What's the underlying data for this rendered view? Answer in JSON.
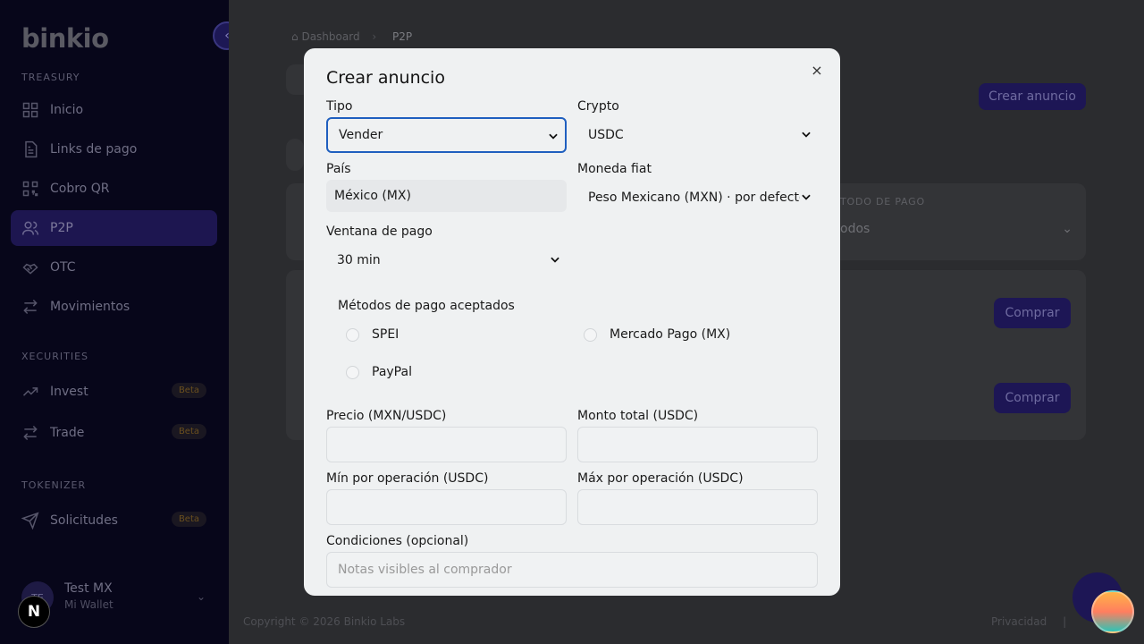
{
  "sidebar": {
    "logo": "binkio",
    "sections": {
      "treasury": "TREASURY",
      "securities": "XECURITIES",
      "tokenizer": "TOKENIZER"
    },
    "items": [
      {
        "label": "Inicio",
        "icon": "grid-icon"
      },
      {
        "label": "Links de pago",
        "icon": "document-icon"
      },
      {
        "label": "Cobro QR",
        "icon": "qr-icon"
      },
      {
        "label": "P2P",
        "icon": "users-icon"
      },
      {
        "label": "OTC",
        "icon": "handshake-icon"
      },
      {
        "label": "Movimientos",
        "icon": "swap-icon"
      },
      {
        "label": "Invest",
        "icon": "trend-icon",
        "badge": "Beta"
      },
      {
        "label": "Trade",
        "icon": "swap-icon",
        "badge": "Beta"
      },
      {
        "label": "Solicitudes",
        "icon": "send-icon",
        "badge": "Beta"
      }
    ],
    "user": {
      "initials": "TE",
      "name": "Test MX",
      "subtitle": "Mi Wallet"
    }
  },
  "main": {
    "breadcrumb": {
      "home": "Dashboard",
      "current": "P2P"
    },
    "create_button": "Crear anuncio",
    "filter_label": "TODO DE PAGO",
    "filter_value": "odos",
    "buy_buttons": [
      "Comprar",
      "Comprar"
    ],
    "footer": {
      "copyright": "Copyright © 2026 Binkio Labs",
      "privacy": "Privacidad",
      "separator": "|"
    }
  },
  "modal": {
    "title": "Crear anuncio",
    "close": "×",
    "tipo": {
      "label": "Tipo",
      "value": "Vender"
    },
    "crypto": {
      "label": "Crypto",
      "value": "USDC"
    },
    "pais": {
      "label": "País",
      "value": "México (MX)"
    },
    "moneda": {
      "label": "Moneda fiat",
      "value": "Peso Mexicano (MXN) · por defecto"
    },
    "ventana": {
      "label": "Ventana de pago",
      "value": "30 min"
    },
    "metodos": {
      "label": "Métodos de pago aceptados",
      "options": [
        "SPEI",
        "Mercado Pago (MX)",
        "PayPal"
      ]
    },
    "precio": {
      "label": "Precio (MXN/USDC)"
    },
    "monto": {
      "label": "Monto total (USDC)"
    },
    "min": {
      "label": "Mín por operación (USDC)"
    },
    "max": {
      "label": "Máx por operación (USDC)"
    },
    "condiciones": {
      "label": "Condiciones (opcional)",
      "placeholder": "Notas visibles al comprador"
    }
  }
}
